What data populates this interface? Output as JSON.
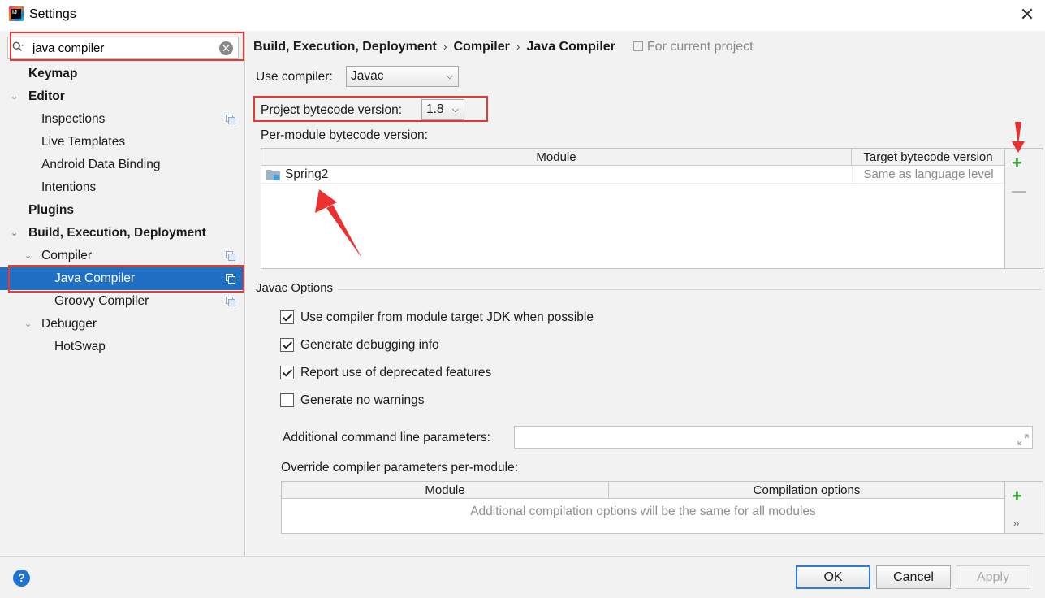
{
  "window": {
    "title": "Settings",
    "close_glyph": "✕",
    "icon_text": "IJ"
  },
  "search": {
    "value": "java compiler",
    "clear_glyph": "✕"
  },
  "tree": {
    "items": [
      {
        "label": "Keymap",
        "bold": true,
        "arrow": ""
      },
      {
        "label": "Editor",
        "bold": true,
        "arrow": "⌄"
      },
      {
        "label": "Inspections"
      },
      {
        "label": "Live Templates"
      },
      {
        "label": "Android Data Binding"
      },
      {
        "label": "Intentions"
      },
      {
        "label": "Plugins",
        "bold": true
      },
      {
        "label": "Build, Execution, Deployment",
        "bold": true,
        "arrow": "⌄"
      },
      {
        "label": "Compiler",
        "arrow": "⌄"
      },
      {
        "label": "Java Compiler",
        "selected": true
      },
      {
        "label": "Groovy Compiler"
      },
      {
        "label": "Debugger",
        "arrow": "⌄"
      },
      {
        "label": "HotSwap"
      }
    ]
  },
  "breadcrumb": {
    "parts": [
      "Build, Execution, Deployment",
      "Compiler",
      "Java Compiler"
    ],
    "separator": "›",
    "scope": "For current project"
  },
  "compiler": {
    "use_compiler_label": "Use compiler:",
    "use_compiler_value": "Javac",
    "bytecode_label": "Project bytecode version:",
    "bytecode_value": "1.8",
    "per_module_label": "Per-module bytecode version:"
  },
  "module_table": {
    "headers": [
      "Module",
      "Target bytecode version"
    ],
    "rows": [
      {
        "module": "Spring2",
        "target": "Same as language level"
      }
    ],
    "add_glyph": "+",
    "remove_glyph": "—"
  },
  "javac": {
    "group_title": "Javac Options",
    "options": [
      {
        "label": "Use compiler from module target JDK when possible",
        "checked": true
      },
      {
        "label": "Generate debugging info",
        "checked": true
      },
      {
        "label": "Report use of deprecated features",
        "checked": true
      },
      {
        "label": "Generate no warnings",
        "checked": false
      }
    ],
    "additional_params_label": "Additional command line parameters:",
    "additional_params_value": "",
    "override_label": "Override compiler parameters per-module:",
    "override_headers": [
      "Module",
      "Compilation options"
    ],
    "override_empty": "Additional compilation options will be the same for all modules",
    "override_more_glyph": "››"
  },
  "footer": {
    "help": "?",
    "ok": "OK",
    "cancel": "Cancel",
    "apply": "Apply"
  },
  "colors": {
    "selection": "#1f6fc5",
    "highlight": "#e53935",
    "add": "#2c9b2c"
  }
}
